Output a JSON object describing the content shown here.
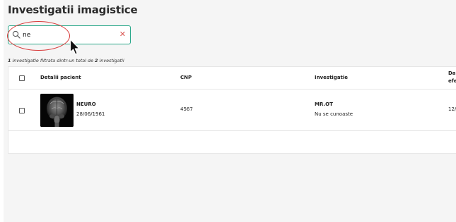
{
  "page": {
    "title": "Investigatii imagistice"
  },
  "search": {
    "value": "ne",
    "placeholder": ""
  },
  "filter_summary": {
    "count": "1",
    "text_a": " investigatie filtrata dintr-un total de ",
    "total": "2",
    "text_b": " investigatii"
  },
  "table": {
    "columns": [
      "Detalii pacient",
      "CNP",
      "Investigatie",
      "Da",
      "efe"
    ],
    "rows": [
      {
        "patient_name": "NEURO",
        "birth_date": "28/06/1961",
        "cnp": "4567",
        "investigation": "MR.OT",
        "investigation_sub": "Nu se cunoaste",
        "date_partial": "12/"
      }
    ]
  },
  "colors": {
    "accent": "#2aa88a",
    "clear": "#d9534f",
    "highlight": "#d83a3a"
  },
  "icons": [
    "search-icon",
    "clear-icon",
    "mouse-cursor-icon",
    "mri-thumbnail"
  ]
}
